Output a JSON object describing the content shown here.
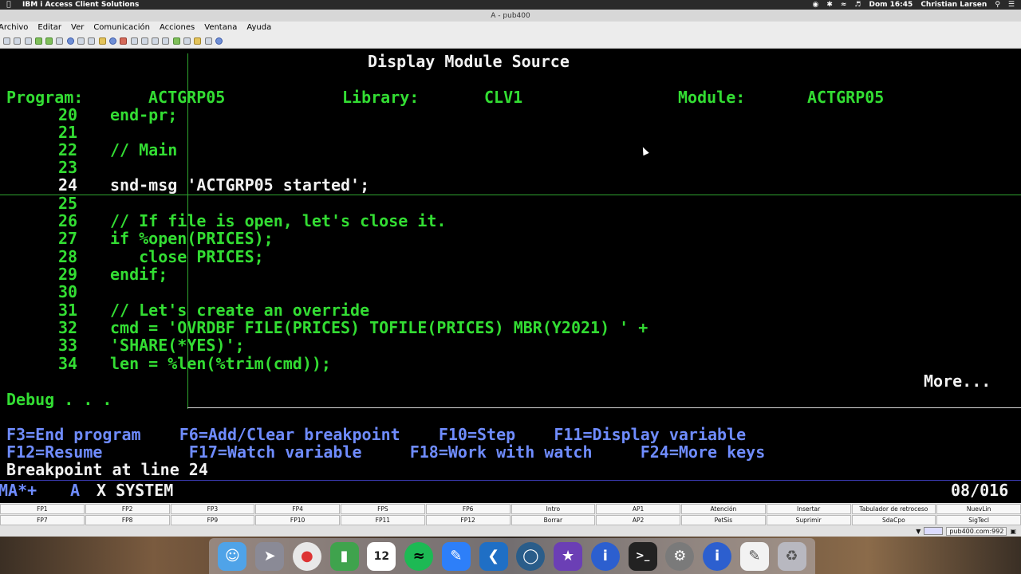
{
  "menubar": {
    "app_name": "IBM i Access Client Solutions",
    "clock": "Dom 16:45",
    "user": "Christian Larsen"
  },
  "window": {
    "title": "A - pub400"
  },
  "app_menu": [
    "Archivo",
    "Editar",
    "Ver",
    "Comunicación",
    "Acciones",
    "Ventana",
    "Ayuda"
  ],
  "terminal": {
    "screen_title": "Display Module Source",
    "program_label": "Program:",
    "program_value": "ACTGRP05",
    "library_label": "Library:",
    "library_value": "CLV1",
    "module_label": "Module:",
    "module_value": "ACTGRP05",
    "source_lines": [
      {
        "num": "20",
        "code": "end-pr;"
      },
      {
        "num": "21",
        "code": ""
      },
      {
        "num": "22",
        "code": "// Main"
      },
      {
        "num": "23",
        "code": ""
      },
      {
        "num": "24",
        "code": "snd-msg 'ACTGRP05 started';"
      },
      {
        "num": "25",
        "code": ""
      },
      {
        "num": "26",
        "code": "// If file is open, let's close it."
      },
      {
        "num": "27",
        "code": "if %open(PRICES);"
      },
      {
        "num": "28",
        "code": "   close PRICES;"
      },
      {
        "num": "29",
        "code": "endif;"
      },
      {
        "num": "30",
        "code": ""
      },
      {
        "num": "31",
        "code": "// Let's create an override"
      },
      {
        "num": "32",
        "code": "cmd = 'OVRDBF FILE(PRICES) TOFILE(PRICES) MBR(Y2021) ' +"
      },
      {
        "num": "33",
        "code": "'SHARE(*YES)';"
      },
      {
        "num": "34",
        "code": "len = %len(%trim(cmd));"
      }
    ],
    "more": "More...",
    "debug_prompt": "Debug . . .",
    "fkey_line1": "F3=End program    F6=Add/Clear breakpoint    F10=Step    F11=Display variable",
    "fkey_line2": "F12=Resume         F17=Watch variable     F18=Work with watch     F24=More keys",
    "message": "Breakpoint at line 24",
    "status_left": "MA*+",
    "status_a": "A",
    "status_x": "X SYSTEM",
    "status_date": "08/016"
  },
  "function_keys_row1": [
    "FP1",
    "FP2",
    "FP3",
    "FP4",
    "FPS",
    "FP6",
    "Intro",
    "AP1",
    "Atención",
    "Insertar",
    "Tabulador de retroceso",
    "NuevLin"
  ],
  "function_keys_row2": [
    "FP7",
    "FP8",
    "FP9",
    "FP10",
    "FP11",
    "FP12",
    "Borrar",
    "AP2",
    "PetSis",
    "Suprimir",
    "SdaCpo",
    "SigTecl"
  ],
  "status_bar": {
    "host": "pub400.com:992"
  },
  "dock_icons": [
    "finder-icon",
    "launchpad-icon",
    "chrome-icon",
    "numbers-icon",
    "calendar-icon",
    "spotify-icon",
    "xcode-icon",
    "vscode-icon",
    "browser-icon",
    "imovie-icon",
    "ibm-i-icon",
    "terminal-icon",
    "system-preferences-icon",
    "ibm-i-icon-2",
    "textedit-icon",
    "trash-icon"
  ],
  "calendar_day": "12",
  "colors": {
    "terminal_green": "#33dd33",
    "terminal_white": "#f2f2f2",
    "terminal_blue": "#6f8cff"
  }
}
